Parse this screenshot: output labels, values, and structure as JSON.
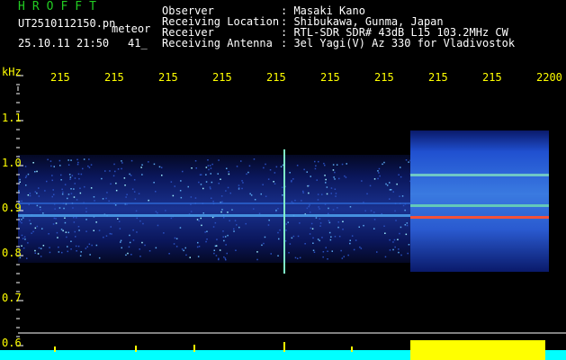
{
  "app": {
    "name": "HROFFT"
  },
  "file": {
    "filename": "UT2510112150.pn",
    "label": "meteor",
    "date_time": "25.10.11 21:50",
    "extra": "41_"
  },
  "info": [
    {
      "key": "Observer",
      "value": ": Masaki Kano"
    },
    {
      "key": "Receiving Location",
      "value": ": Shibukawa, Gunma, Japan"
    },
    {
      "key": "Receiver",
      "value": ": RTL-SDR SDR# 43dB L15 103.2MHz CW"
    },
    {
      "key": "Receiving Antenna",
      "value": ": 3el Yagi(V) Az 330 for Vladivostok"
    }
  ],
  "time_axis": {
    "labels": [
      "215",
      "215",
      "215",
      "215",
      "215",
      "215",
      "215",
      "215",
      "215",
      "2200"
    ]
  },
  "freq_axis": {
    "unit": "kHz",
    "labels": [
      "1.1",
      "1.0",
      "0.9",
      "0.8",
      "0.7",
      "0.6"
    ]
  },
  "colors": {
    "title": "#22cc22",
    "text": "#ffffff",
    "axis_labels": "#ffff00",
    "power_trace": "#00ffff",
    "meteor_trace": "#ffff00"
  }
}
